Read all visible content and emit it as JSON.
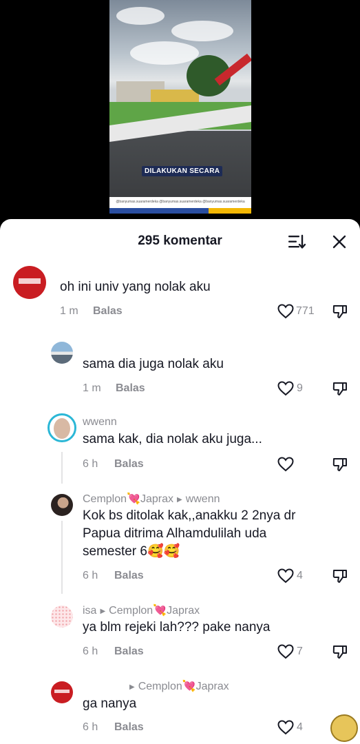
{
  "video": {
    "caption": "DILAKUKAN SECARA",
    "footer_text": "@banyumas.suaramerdeka   @banyumas.suaramerdeka   @banyumas.suaramerdeka"
  },
  "sheet": {
    "title": "295 komentar",
    "sort_icon": "sort-icon",
    "close_icon": "close-icon"
  },
  "comments": [
    {
      "username": "",
      "text": "oh ini univ yang nolak aku",
      "time": "1 m",
      "reply_label": "Balas",
      "likes": "771"
    },
    {
      "username": "",
      "text": "sama dia juga nolak aku",
      "time": "1 m",
      "reply_label": "Balas",
      "likes": "9"
    },
    {
      "username": "wwenn",
      "text": "sama kak, dia nolak aku juga...",
      "time": "6 h",
      "reply_label": "Balas",
      "likes": ""
    },
    {
      "username": "Cemplon💘Japrax",
      "reply_to": "wwenn",
      "text_lines": [
        "Kok bs ditolak kak,,anakku 2 2nya dr",
        "Papua ditrima Alhamdulilah uda",
        "semester 6🥰🥰"
      ],
      "time": "6 h",
      "reply_label": "Balas",
      "likes": "4"
    },
    {
      "username": "isa",
      "reply_to": "Cemplon💘Japrax",
      "text": "ya blm rejeki lah??? pake nanya",
      "time": "6 h",
      "reply_label": "Balas",
      "likes": "7"
    },
    {
      "username": "",
      "reply_to": "Cemplon💘Japrax",
      "text": "ga nanya",
      "time": "6 h",
      "reply_label": "Balas",
      "likes": "4"
    }
  ]
}
